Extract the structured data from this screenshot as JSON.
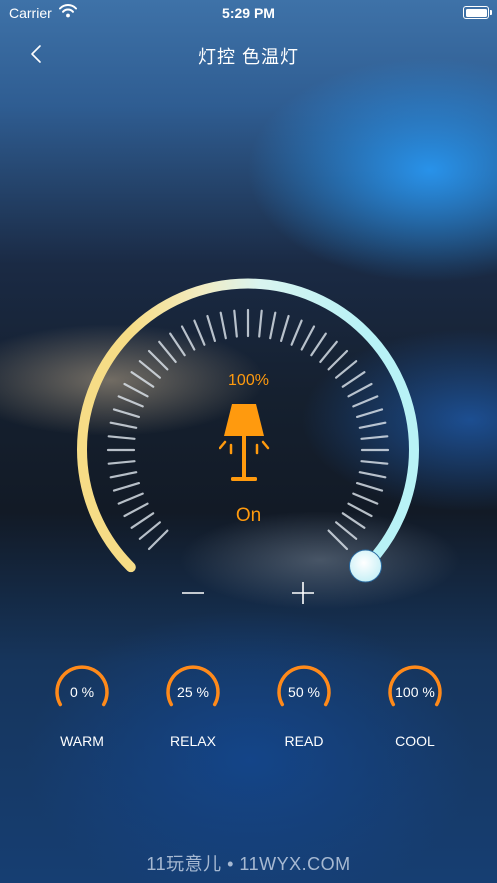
{
  "status": {
    "carrier": "Carrier",
    "time": "5:29 PM"
  },
  "header": {
    "title": "灯控 色温灯",
    "back_icon": "chevron-left-icon"
  },
  "dial": {
    "brightness_text": "100%",
    "brightness_value": 100,
    "power_text": "On",
    "lamp_icon": "lamp-icon",
    "accent_color": "#ff9a0e",
    "minus_icon": "minus-icon",
    "plus_icon": "plus-icon"
  },
  "presets": [
    {
      "value": "0 %",
      "label": "WARM"
    },
    {
      "value": "25 %",
      "label": "RELAX"
    },
    {
      "value": "50 %",
      "label": "READ"
    },
    {
      "value": "100 %",
      "label": "COOL"
    }
  ],
  "watermark": "11玩意儿 • 11WYX.COM"
}
